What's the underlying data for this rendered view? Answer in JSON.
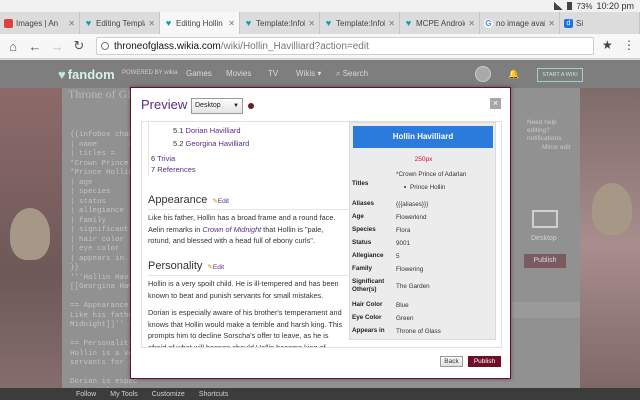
{
  "status_bar": {
    "battery": "73%",
    "time": "10:20 pm"
  },
  "tabs": [
    {
      "title": "Images | An",
      "favicon": "red-square-icon"
    },
    {
      "title": "Editing Template:",
      "favicon": "fandom-heart-icon"
    },
    {
      "title": "Editing Hollin Ha",
      "favicon": "fandom-heart-icon",
      "active": true
    },
    {
      "title": "Template:Infobox",
      "favicon": "fandom-heart-icon"
    },
    {
      "title": "Template:Infobox",
      "favicon": "fandom-heart-icon"
    },
    {
      "title": "MCPE Android S",
      "favicon": "fandom-heart-icon"
    },
    {
      "title": "no image availa",
      "favicon": "google-g-icon"
    },
    {
      "title": "Si",
      "favicon": "d-app-icon"
    }
  ],
  "address_bar": {
    "host": "throneofglass.wikia.com",
    "path": "/wiki/Hollin_Havilliard?action=edit"
  },
  "fandom_nav": {
    "logo": "fandom",
    "powered": "POWERED BY wikia",
    "items": [
      "Games",
      "Movies",
      "TV",
      "Wikis ▾"
    ],
    "search": "Search",
    "start_wiki": "START A WIKI"
  },
  "background_page": {
    "wiki_title": "Throne of Glass W",
    "help_text": "Need help editing? notifications",
    "minor_edit": "Minor edit",
    "desktop_label": "Desktop",
    "publish_label": "Publish",
    "editor_lines": [
      "{{infobox chara",
      "| name       =",
      "| titles =",
      "*Crown Prince o",
      "*Prince Hollin",
      "| age",
      "| species",
      "| status",
      "| allegiance",
      "| family",
      "| significant o",
      "| hair color",
      "| eye color",
      "| appears in",
      "}}",
      "'''Hollin Havil",
      "[[Georgina Havi",
      "",
      "== Appearance =",
      "Like his father",
      "Midnight]]'' th",
      "",
      "== Personality",
      "Hollin is a ver",
      "servants for sm",
      "",
      "Dorian is espec",
      "p terrible and"
    ],
    "toolbar": [
      "Follow",
      "My Tools",
      "Customize",
      "Shortcuts"
    ]
  },
  "modal": {
    "title": "Preview",
    "skin_select": "Desktop",
    "close": "×",
    "toc": [
      {
        "num": "5.1",
        "label": "Dorian Havilliard"
      },
      {
        "num": "5.2",
        "label": "Georgina Havilliard"
      },
      {
        "num": "6",
        "label": "Trivia"
      },
      {
        "num": "7",
        "label": "References"
      }
    ],
    "sections": {
      "appearance": {
        "heading": "Appearance",
        "edit": "Edit",
        "text_before": "Like his father, Hollin has a broad frame and a round face. Aelin remarks in ",
        "text_link": "Crown of Midnight",
        "text_after": " that Hollin is \"pale, rotund, and blessed with a head full of ebony curls\"."
      },
      "personality": {
        "heading": "Personality",
        "edit": "Edit",
        "para1": "Hollin is a very spoilt child. He is ill-tempered and has been known to beat and punish servants for small mistakes.",
        "para2": "Dorian is especially aware of his brother's temperament and knows that Hollin would make a terrible and harsh king. This prompts him to decline Sorscha's offer to leave, as he is afraid of what will happen should Hollin become king of Adarlan."
      }
    },
    "infobox": {
      "name": "Hollin Havilliard",
      "image": "250px",
      "titles_label": "Titles",
      "titles": [
        "*Crown Prince of Adarlan",
        "Prince Hollin"
      ],
      "rows": [
        {
          "label": "Aliases",
          "value": "{{{aliases}}}"
        },
        {
          "label": "Age",
          "value": "Flowerkind"
        },
        {
          "label": "Species",
          "value": "Flora"
        },
        {
          "label": "Status",
          "value": "9001"
        },
        {
          "label": "Allegiance",
          "value": "5"
        },
        {
          "label": "Family",
          "value": "Flowering"
        },
        {
          "label": "Significant Other(s)",
          "value": "The Garden"
        },
        {
          "label": "Hair Color",
          "value": "Blue"
        },
        {
          "label": "Eye Color",
          "value": "Green"
        },
        {
          "label": "Appears in",
          "value": "Throne of Glass"
        }
      ]
    },
    "buttons": {
      "back": "Back",
      "publish": "Publish"
    }
  }
}
